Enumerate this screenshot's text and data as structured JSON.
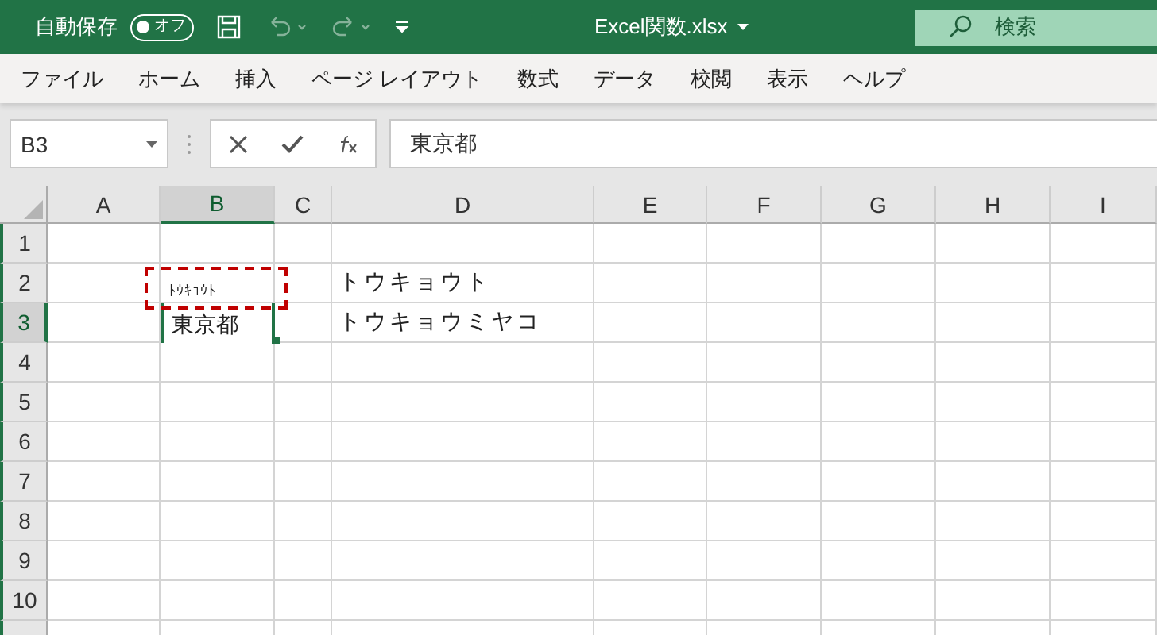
{
  "title_bar": {
    "autosave_label": "自動保存",
    "autosave_toggle": {
      "label": "オフ",
      "on": false
    },
    "file_name": "Excel関数.xlsx",
    "search": {
      "placeholder": "検索"
    }
  },
  "ribbon_tabs": [
    "ファイル",
    "ホーム",
    "挿入",
    "ページ レイアウト",
    "数式",
    "データ",
    "校閲",
    "表示",
    "ヘルプ"
  ],
  "formula_bar": {
    "name_box": "B3",
    "value": "東京都"
  },
  "sheet": {
    "columns": [
      {
        "label": "A",
        "selected": false
      },
      {
        "label": "B",
        "selected": true
      },
      {
        "label": "C",
        "selected": false
      },
      {
        "label": "D",
        "selected": false
      },
      {
        "label": "E",
        "selected": false
      },
      {
        "label": "F",
        "selected": false
      },
      {
        "label": "G",
        "selected": false
      },
      {
        "label": "H",
        "selected": false
      },
      {
        "label": "I",
        "selected": false
      }
    ],
    "rows": [
      {
        "label": "1",
        "selected": false
      },
      {
        "label": "2",
        "selected": false,
        "column_d": "トウキョウト"
      },
      {
        "label": "3",
        "selected": true,
        "column_d": "トウキョウミヤコ",
        "editing_b": {
          "text": "東京都",
          "phonetic": "ﾄｳｷｮｳﾄ"
        }
      },
      {
        "label": "4",
        "selected": false
      },
      {
        "label": "5",
        "selected": false
      },
      {
        "label": "6",
        "selected": false
      },
      {
        "label": "7",
        "selected": false
      },
      {
        "label": "8",
        "selected": false
      },
      {
        "label": "9",
        "selected": false
      },
      {
        "label": "10",
        "selected": false
      }
    ]
  }
}
